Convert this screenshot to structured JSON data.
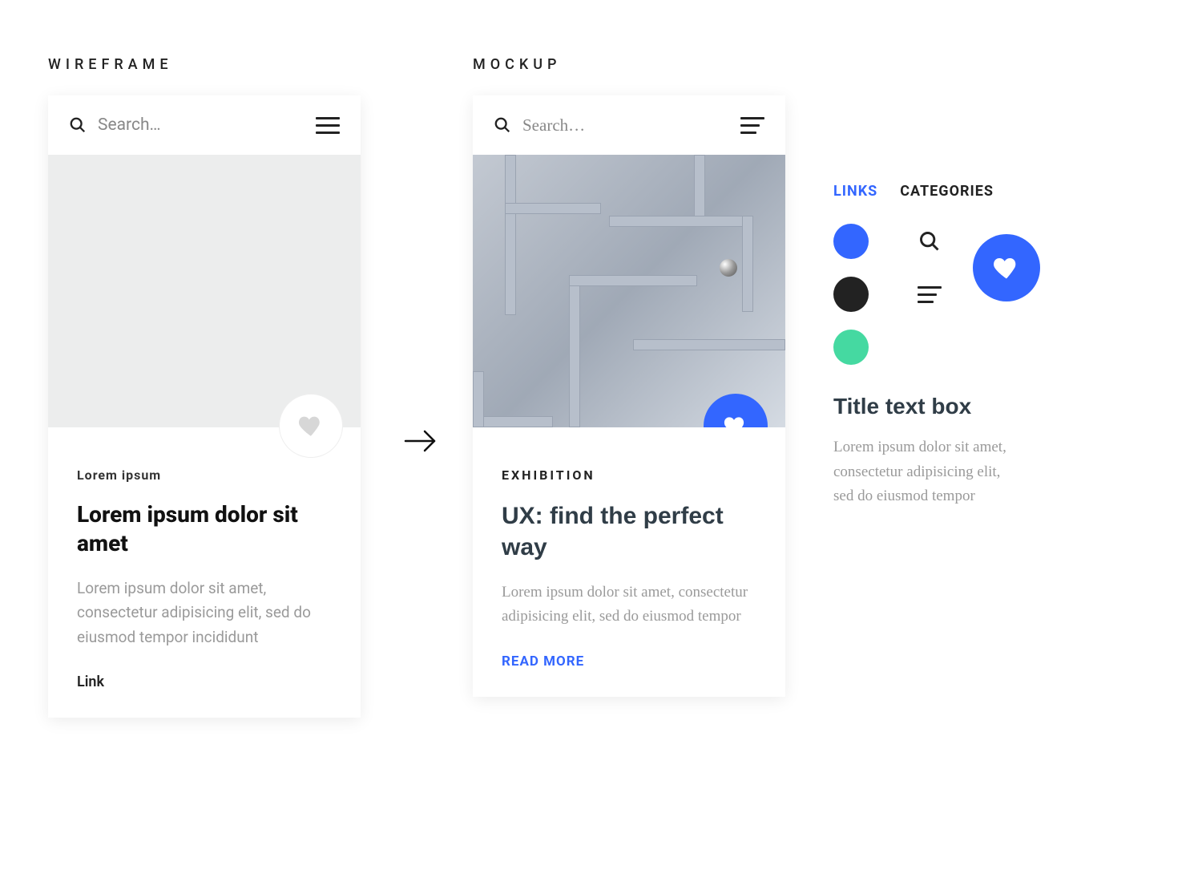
{
  "labels": {
    "wireframe": "WIREFRAME",
    "mockup": "MOCKUP"
  },
  "wireframe": {
    "search_placeholder": "Search…",
    "eyebrow": "Lorem ipsum",
    "title": "Lorem ipsum dolor sit amet",
    "desc": "Lorem ipsum dolor sit amet, consectetur adipisicing elit, sed do eiusmod tempor incididunt",
    "link": "Link"
  },
  "mockup": {
    "search_placeholder": "Search…",
    "eyebrow": "EXHIBITION",
    "title": "UX: find the perfect way",
    "desc": "Lorem ipsum dolor sit amet, consectetur adipisicing elit, sed do eiusmod tempor",
    "link": "READ MORE"
  },
  "sidebar": {
    "tabs": {
      "links": "LINKS",
      "categories": "CATEGORIES"
    },
    "swatches": {
      "blue": "#3366ff",
      "dark": "#222222",
      "mint": "#45d9a1"
    },
    "title": "Title text box",
    "body": "Lorem ipsum dolor sit amet, consectetur adipisicing elit, sed do eiusmod tempor"
  },
  "colors": {
    "accent": "#3366ff"
  }
}
